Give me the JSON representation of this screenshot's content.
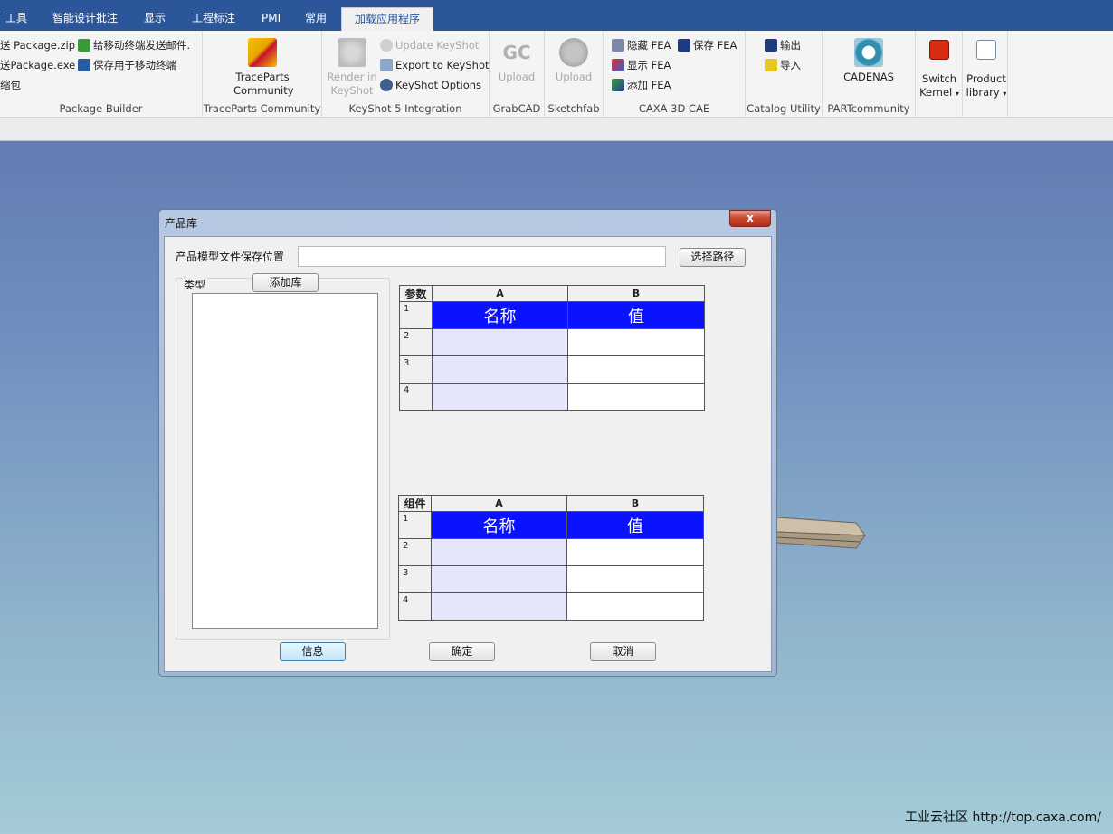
{
  "menubar": {
    "tabs": [
      {
        "label": "工具"
      },
      {
        "label": "智能设计批注"
      },
      {
        "label": "显示"
      },
      {
        "label": "工程标注"
      },
      {
        "label": "PMI"
      },
      {
        "label": "常用"
      },
      {
        "label": "加载应用程序"
      }
    ],
    "active_tab": "加载应用程序"
  },
  "ribbon": {
    "package_builder": {
      "label": "Package Builder",
      "items": [
        "送 Package.zip",
        "送Package.exe",
        "缩包",
        "给移动终端发送邮件.",
        "保存用于移动终端"
      ]
    },
    "traceparts": {
      "label": "TraceParts Community",
      "button_line1": "TraceParts",
      "button_line2": "Community"
    },
    "keyshot": {
      "label": "KeyShot 5 Integration",
      "render_line1": "Render in",
      "render_line2": "KeyShot",
      "update": "Update KeyShot",
      "export": "Export to KeyShot",
      "options": "KeyShot Options"
    },
    "grabcad": {
      "label": "GrabCAD",
      "button": "Upload",
      "logo": "GC"
    },
    "sketchfab": {
      "label": "Sketchfab",
      "button": "Upload"
    },
    "caxa": {
      "label": "CAXA 3D CAE",
      "hide": "隐藏 FEA",
      "save": "保存 FEA",
      "show": "显示 FEA",
      "add": "添加 FEA"
    },
    "catalog": {
      "label": "Catalog Utility",
      "output": "输出",
      "input": "导入"
    },
    "partcommunity": {
      "label": "PARTcommunity",
      "button": "CADENAS"
    },
    "switch_kernel": {
      "line1": "Switch",
      "line2": "Kernel"
    },
    "product_library": {
      "line1": "Product",
      "line2": "library"
    }
  },
  "dialog": {
    "title": "产品库",
    "close": "x",
    "path_label": "产品模型文件保存位置",
    "path_value": "",
    "choose_path": "选择路径",
    "type_label": "类型",
    "add_library": "添加库",
    "info": "信息",
    "ok": "确定",
    "cancel": "取消",
    "params_grid": {
      "corner": "参数",
      "col_a": "A",
      "col_b": "B",
      "rows": [
        {
          "num": "1",
          "a": "名称",
          "b": "值"
        },
        {
          "num": "2",
          "a": "",
          "b": ""
        },
        {
          "num": "3",
          "a": "",
          "b": ""
        },
        {
          "num": "4",
          "a": "",
          "b": ""
        }
      ]
    },
    "components_grid": {
      "corner": "组件",
      "col_a": "A",
      "col_b": "B",
      "rows": [
        {
          "num": "1",
          "a": "名称",
          "b": "值"
        },
        {
          "num": "2",
          "a": "",
          "b": ""
        },
        {
          "num": "3",
          "a": "",
          "b": ""
        },
        {
          "num": "4",
          "a": "",
          "b": ""
        }
      ]
    }
  },
  "watermark": "工业云社区 http://top.caxa.com/",
  "colors": {
    "menubar": "#2b579a",
    "grid_header_row": "#0a12ff",
    "grid_col_a": "#e6e6fa"
  }
}
